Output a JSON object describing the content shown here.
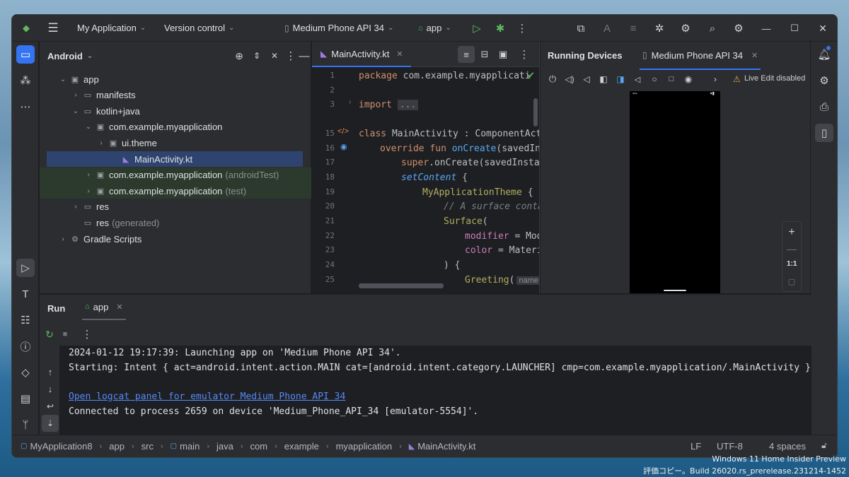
{
  "titlebar": {
    "app_name": "My Application",
    "vcs": "Version control",
    "device": "Medium Phone API 34",
    "run_config": "app"
  },
  "project": {
    "view_mode": "Android",
    "tree": [
      {
        "label": "app",
        "extra": "",
        "indent": 0,
        "arrow": "⌄",
        "icon": "module-icon",
        "selected": false,
        "tint": ""
      },
      {
        "label": "manifests",
        "extra": "",
        "indent": 1,
        "arrow": "›",
        "icon": "folder-icon",
        "selected": false,
        "tint": ""
      },
      {
        "label": "kotlin+java",
        "extra": "",
        "indent": 1,
        "arrow": "⌄",
        "icon": "folder-icon",
        "selected": false,
        "tint": ""
      },
      {
        "label": "com.example.myapplication",
        "extra": "",
        "indent": 2,
        "arrow": "⌄",
        "icon": "package-icon",
        "selected": false,
        "tint": ""
      },
      {
        "label": "ui.theme",
        "extra": "",
        "indent": 3,
        "arrow": "›",
        "icon": "package-icon",
        "selected": false,
        "tint": ""
      },
      {
        "label": "MainActivity.kt",
        "extra": "",
        "indent": 4,
        "arrow": "",
        "icon": "kotlin-file-icon",
        "selected": true,
        "tint": ""
      },
      {
        "label": "com.example.myapplication",
        "extra": "(androidTest)",
        "indent": 2,
        "arrow": "›",
        "icon": "package-icon",
        "selected": false,
        "tint": "green"
      },
      {
        "label": "com.example.myapplication",
        "extra": "(test)",
        "indent": 2,
        "arrow": "›",
        "icon": "package-icon",
        "selected": false,
        "tint": "green"
      },
      {
        "label": "res",
        "extra": "",
        "indent": 1,
        "arrow": "›",
        "icon": "folder-icon",
        "selected": false,
        "tint": ""
      },
      {
        "label": "res",
        "extra": "(generated)",
        "indent": 1,
        "arrow": "",
        "icon": "folder-icon",
        "selected": false,
        "tint": ""
      },
      {
        "label": "Gradle Scripts",
        "extra": "",
        "indent": 0,
        "arrow": "›",
        "icon": "gradle-icon",
        "selected": false,
        "tint": ""
      }
    ]
  },
  "editor": {
    "tab": "MainActivity.kt",
    "line_numbers": [
      "1",
      "2",
      "3",
      "15",
      "16",
      "17",
      "18",
      "19",
      "20",
      "21",
      "22",
      "23",
      "24",
      "25"
    ],
    "lines": {
      "l1_kw": "package",
      "l1_rest": " com.example.myapplicati",
      "l3_kw": "import",
      "l3_fold": "...",
      "l15_kw": "class",
      "l15_rest": " MainActivity : ComponentActi",
      "l16_kw": "override fun",
      "l16_fn": "onCreate",
      "l16_rest": "(savedIns",
      "l17_kw": "super",
      "l17_rest": ".onCreate(savedInstan",
      "l18_fn": "setContent",
      "l18_rest": " {",
      "l19_fn": "MyApplicationTheme",
      "l19_rest": " {",
      "l20_cm": "// A surface conta",
      "l21_fn": "Surface",
      "l21_rest": "(",
      "l22_pr": "modifier",
      "l22_rest": " = Mod",
      "l23_pr": "color",
      "l23_rest": " = Materi",
      "l24": ") {",
      "l25_fn": "Greeting",
      "l25_rest": "(",
      "l25_hint": "name"
    }
  },
  "devices": {
    "title": "Running Devices",
    "tab": "Medium Phone API 34",
    "live_edit": "Live Edit disabled",
    "zoom_label": "1:1"
  },
  "run": {
    "title": "Run",
    "tab": "app",
    "console": {
      "line1": "2024-01-12 19:17:39: Launching app on 'Medium Phone API 34'.",
      "line2": "Starting: Intent { act=android.intent.action.MAIN cat=[android.intent.category.LAUNCHER] cmp=com.example.myapplication/.MainActivity }",
      "link": "Open logcat panel for emulator Medium Phone API 34",
      "line4": "Connected to process 2659 on device 'Medium_Phone_API_34 [emulator-5554]'."
    }
  },
  "status": {
    "crumbs": [
      "MyApplication8",
      "app",
      "src",
      "main",
      "java",
      "com",
      "example",
      "myapplication",
      "MainActivity.kt"
    ],
    "line_sep": "LF",
    "encoding": "UTF-8",
    "indent": "4 spaces"
  },
  "watermark": {
    "line1": "Windows 11 Home Insider Preview",
    "line2": "評価コピー。Build 26020.rs_prerelease.231214-1452"
  }
}
